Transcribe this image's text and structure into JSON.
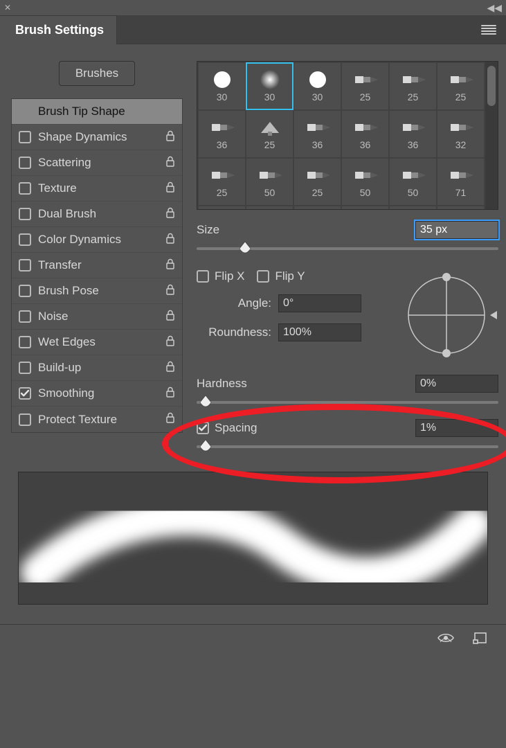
{
  "panel": {
    "title": "Brush Settings",
    "brushes_button": "Brushes"
  },
  "categories": [
    {
      "label": "Brush Tip Shape",
      "checkable": false,
      "checked": false,
      "has_lock": false,
      "selected": true
    },
    {
      "label": "Shape Dynamics",
      "checkable": true,
      "checked": false,
      "has_lock": true,
      "selected": false
    },
    {
      "label": "Scattering",
      "checkable": true,
      "checked": false,
      "has_lock": true,
      "selected": false
    },
    {
      "label": "Texture",
      "checkable": true,
      "checked": false,
      "has_lock": true,
      "selected": false
    },
    {
      "label": "Dual Brush",
      "checkable": true,
      "checked": false,
      "has_lock": true,
      "selected": false
    },
    {
      "label": "Color Dynamics",
      "checkable": true,
      "checked": false,
      "has_lock": true,
      "selected": false
    },
    {
      "label": "Transfer",
      "checkable": true,
      "checked": false,
      "has_lock": true,
      "selected": false
    },
    {
      "label": "Brush Pose",
      "checkable": true,
      "checked": false,
      "has_lock": true,
      "selected": false
    },
    {
      "label": "Noise",
      "checkable": true,
      "checked": false,
      "has_lock": true,
      "selected": false
    },
    {
      "label": "Wet Edges",
      "checkable": true,
      "checked": false,
      "has_lock": true,
      "selected": false
    },
    {
      "label": "Build-up",
      "checkable": true,
      "checked": false,
      "has_lock": true,
      "selected": false
    },
    {
      "label": "Smoothing",
      "checkable": true,
      "checked": true,
      "has_lock": true,
      "selected": false
    },
    {
      "label": "Protect Texture",
      "checkable": true,
      "checked": false,
      "has_lock": true,
      "selected": false
    }
  ],
  "tips": {
    "selected_index": 1,
    "items": [
      {
        "size": "30",
        "icon": "round-hard"
      },
      {
        "size": "30",
        "icon": "round-soft"
      },
      {
        "size": "30",
        "icon": "round-hard"
      },
      {
        "size": "25",
        "icon": "flat-point"
      },
      {
        "size": "25",
        "icon": "flat-curve"
      },
      {
        "size": "25",
        "icon": "flat-fan"
      },
      {
        "size": "36",
        "icon": "flat-point"
      },
      {
        "size": "25",
        "icon": "fan"
      },
      {
        "size": "36",
        "icon": "flat-blunt"
      },
      {
        "size": "36",
        "icon": "flat-blunt"
      },
      {
        "size": "36",
        "icon": "flat-blunt"
      },
      {
        "size": "32",
        "icon": "flat-angle"
      },
      {
        "size": "25",
        "icon": "round-point"
      },
      {
        "size": "50",
        "icon": "liner"
      },
      {
        "size": "25",
        "icon": "liner"
      },
      {
        "size": "50",
        "icon": "liner"
      },
      {
        "size": "50",
        "icon": "liner"
      },
      {
        "size": "71",
        "icon": "liner"
      },
      {
        "size": "",
        "icon": "liner"
      },
      {
        "size": "",
        "icon": "liner"
      },
      {
        "size": "",
        "icon": "liner"
      },
      {
        "size": "",
        "icon": "liner"
      },
      {
        "size": "",
        "icon": "liner"
      },
      {
        "size": "",
        "icon": "liner"
      }
    ]
  },
  "controls": {
    "size_label": "Size",
    "size_value": "35 px",
    "size_selected": true,
    "size_slider_percent": 16,
    "flip_x_label": "Flip X",
    "flip_x_checked": false,
    "flip_y_label": "Flip Y",
    "flip_y_checked": false,
    "angle_label": "Angle:",
    "angle_value": "0°",
    "roundness_label": "Roundness:",
    "roundness_value": "100%",
    "hardness_label": "Hardness",
    "hardness_value": "0%",
    "hardness_slider_percent": 3,
    "spacing_label": "Spacing",
    "spacing_checked": true,
    "spacing_value": "1%",
    "spacing_slider_percent": 3
  },
  "annotation": {
    "spacing_ring": true
  }
}
